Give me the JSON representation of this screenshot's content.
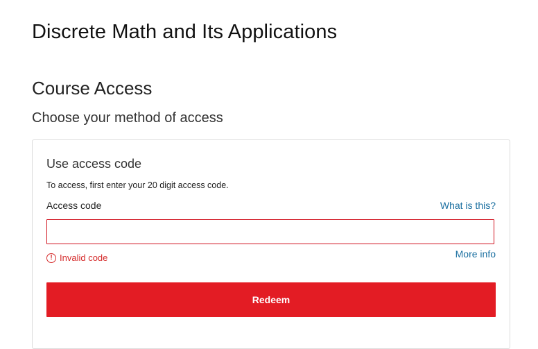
{
  "course": {
    "title": "Discrete Math and Its Applications"
  },
  "access": {
    "heading": "Course Access",
    "subtitle": "Choose your method of access"
  },
  "card": {
    "title": "Use access code",
    "description": "To access, first enter your 20 digit access code.",
    "field_label": "Access code",
    "help_link": "What is this?",
    "input_value": "",
    "error_icon": "!",
    "error_text": "Invalid code",
    "more_link": "More info",
    "button_label": "Redeem"
  },
  "colors": {
    "accent_red": "#e31c24",
    "link_blue": "#1a6fa0",
    "error_red": "#d52b2b"
  },
  "icons": {
    "error": "alert-circle-icon"
  }
}
